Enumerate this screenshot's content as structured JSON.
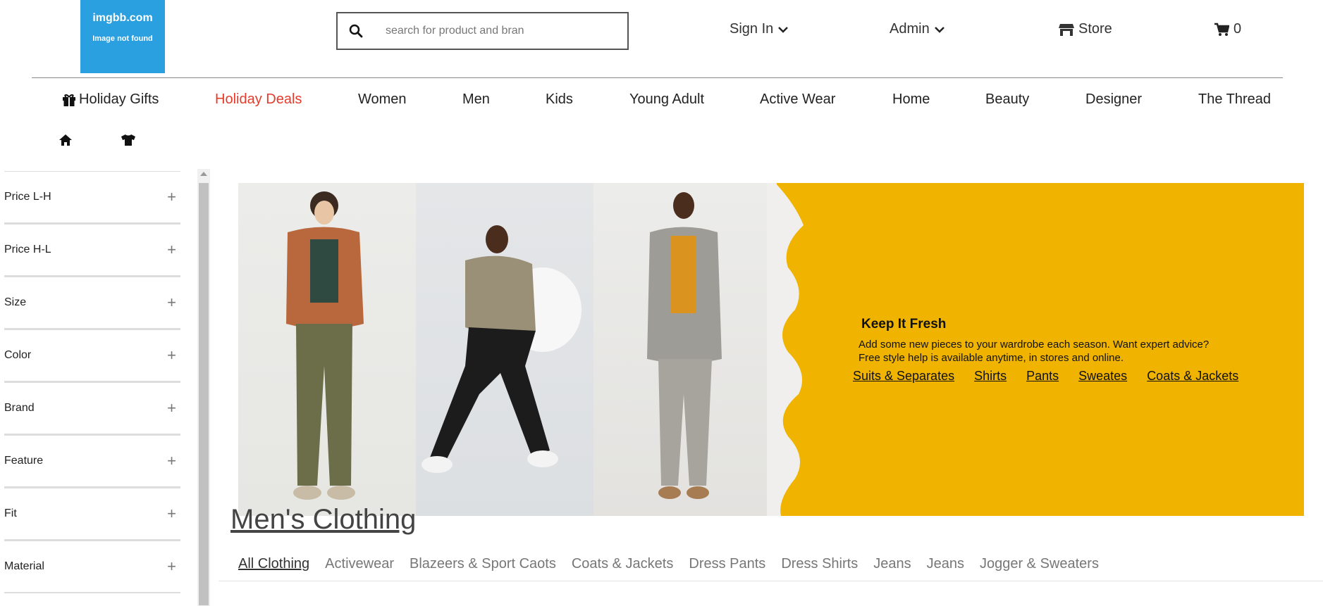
{
  "logo": {
    "line1": "imgbb.com",
    "line2": "Image not found"
  },
  "search": {
    "placeholder": "search for product and bran"
  },
  "header": {
    "sign_in": "Sign In",
    "admin": "Admin",
    "store": "Store",
    "cart_count": "0"
  },
  "nav": [
    "Holiday Gifts",
    "Holiday Deals",
    "Women",
    "Men",
    "Kids",
    "Young Adult",
    "Active Wear",
    "Home",
    "Beauty",
    "Designer",
    "The Thread"
  ],
  "filters": [
    "Price L-H",
    "Price H-L",
    "Size",
    "Color",
    "Brand",
    "Feature",
    "Fit",
    "Material"
  ],
  "banner": {
    "title": "Keep It Fresh",
    "line1": "Add some new pieces to your wardrobe each season. Want expert advice?",
    "line2": "Free style help is available anytime, in stores and online.",
    "links": [
      "Suits & Separates",
      "Shirts",
      "Pants",
      "Sweates",
      "Coats & Jackets"
    ]
  },
  "page_title": "Men's Clothing",
  "categories": [
    "All Clothing",
    "Activewear",
    "Blazeers & Sport Caots",
    "Coats & Jackets",
    "Dress Pants",
    "Dress Shirts",
    "Jeans",
    "Jeans",
    "Jogger & Sweaters"
  ],
  "colors": {
    "accent_red": "#e53b2c",
    "banner_yellow": "#f0b400",
    "logo_blue": "#2aa0e0"
  }
}
